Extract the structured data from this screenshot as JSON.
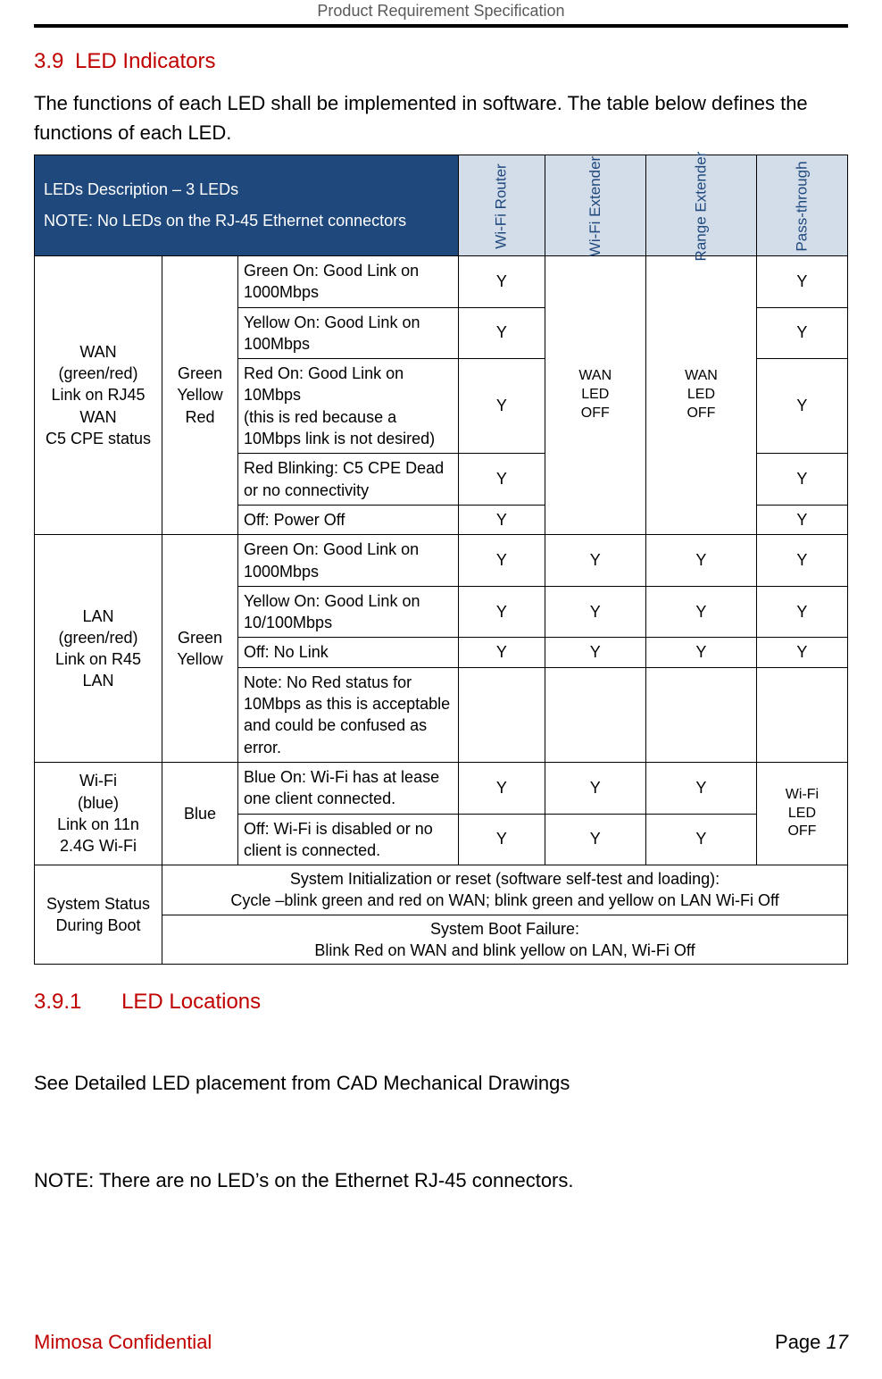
{
  "header": {
    "title": "Product Requirement Specification"
  },
  "section": {
    "number": "3.9",
    "title": "LED Indicators",
    "intro": "The functions of each LED shall be implemented in software. The table below defines the functions of each LED."
  },
  "table": {
    "header_main_line1": "LEDs Description – 3 LEDs",
    "header_main_line2": "NOTE: No LEDs on the RJ-45 Ethernet connectors",
    "mode_headers": [
      "Wi-Fi Router",
      "Wi-Fi Extender",
      "Range Extender",
      "Pass-through"
    ],
    "group_wan": {
      "label": "WAN\n(green/red)\nLink on RJ45\nWAN\nC5 CPE status",
      "colors": "Green\nYellow\nRed",
      "rows": [
        {
          "desc": "Green On: Good Link on 1000Mbps",
          "cols": [
            "Y",
            null,
            null,
            "Y"
          ]
        },
        {
          "desc": "Yellow On: Good Link on 100Mbps",
          "cols": [
            "Y",
            null,
            null,
            "Y"
          ]
        },
        {
          "desc": "Red On: Good Link on 10Mbps\n(this is red because a 10Mbps link is not desired)",
          "cols": [
            "Y",
            null,
            null,
            "Y"
          ]
        },
        {
          "desc": "Red Blinking: C5 CPE Dead or no connectivity",
          "cols": [
            "Y",
            null,
            null,
            "Y"
          ]
        },
        {
          "desc": "Off: Power Off",
          "cols": [
            "Y",
            null,
            null,
            "Y"
          ]
        }
      ],
      "wan_ext_span": "WAN\nLED\nOFF",
      "range_ext_span": "WAN\nLED\nOFF"
    },
    "group_lan": {
      "label": "LAN\n(green/red)\nLink on R45\nLAN",
      "colors": "Green\nYellow",
      "rows": [
        {
          "desc": "Green On: Good Link on 1000Mbps",
          "cols": [
            "Y",
            "Y",
            "Y",
            "Y"
          ]
        },
        {
          "desc": "Yellow On: Good Link on 10/100Mbps",
          "cols": [
            "Y",
            "Y",
            "Y",
            "Y"
          ]
        },
        {
          "desc": "Off: No Link",
          "cols": [
            "Y",
            "Y",
            "Y",
            "Y"
          ]
        },
        {
          "desc": "Note: No Red status for 10Mbps as this is acceptable and could be confused as error.",
          "cols": [
            "",
            "",
            "",
            ""
          ]
        }
      ]
    },
    "group_wifi": {
      "label": "Wi-Fi\n(blue)\nLink on 11n\n2.4G Wi-Fi",
      "colors": "Blue",
      "rows": [
        {
          "desc": "Blue On: Wi-Fi has at lease one client connected.",
          "cols": [
            "Y",
            "Y",
            "Y",
            null
          ]
        },
        {
          "desc": "Off: Wi-Fi is disabled or no client is connected.",
          "cols": [
            "Y",
            "Y",
            "Y",
            null
          ]
        }
      ],
      "pass_span": "Wi-Fi\nLED\nOFF"
    },
    "group_boot": {
      "label": "System Status During Boot",
      "row1": "System Initialization or reset (software self-test and loading):\nCycle –blink green and red on WAN; blink green and yellow on LAN Wi-Fi Off",
      "row2": "System Boot Failure:\nBlink Red on WAN and blink yellow on LAN, Wi-Fi Off"
    }
  },
  "subsection": {
    "number": "3.9.1",
    "title": "LED Locations",
    "body": "See Detailed LED placement from CAD Mechanical Drawings",
    "note": "NOTE:  There are no LED’s on the Ethernet RJ-45 connectors."
  },
  "footer": {
    "left": "Mimosa Confidential",
    "right_label": "Page ",
    "page_num": "17"
  }
}
